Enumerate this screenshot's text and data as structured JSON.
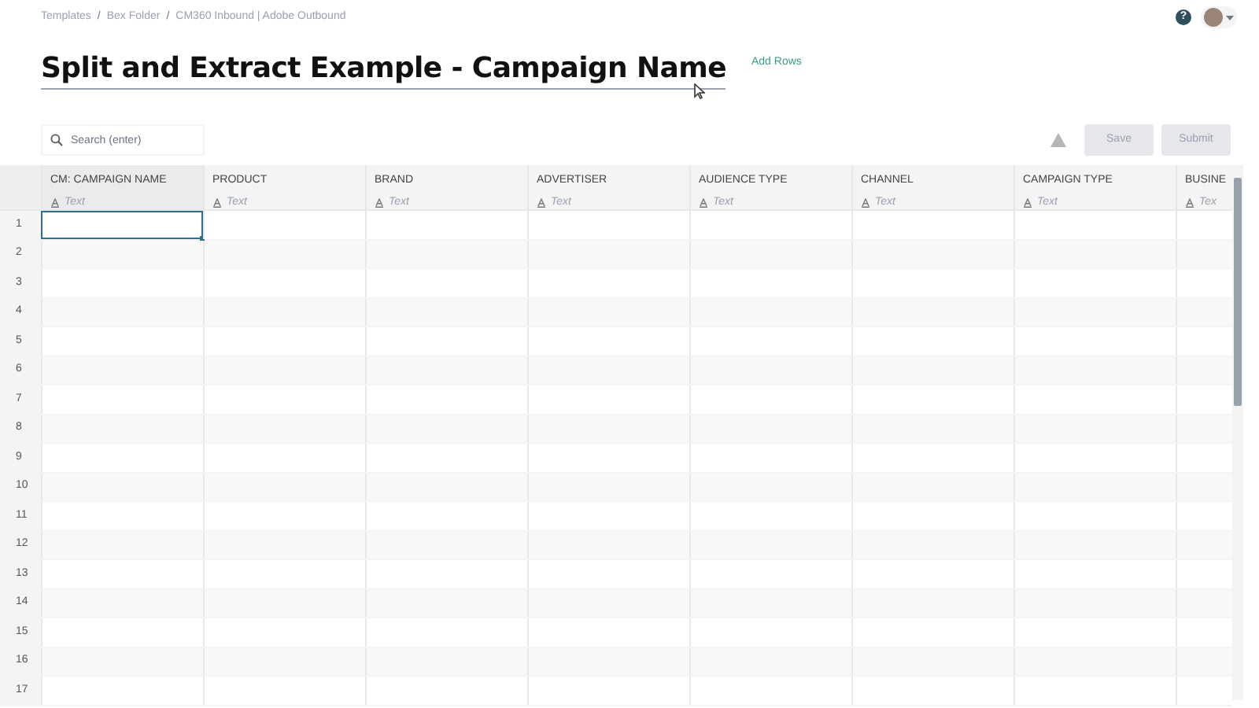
{
  "breadcrumb": {
    "items": [
      "Templates",
      "Bex Folder",
      "CM360 Inbound | Adobe Outbound"
    ],
    "separator": "/"
  },
  "help": {
    "label": "?"
  },
  "title": "Split and Extract Example - Campaign Name",
  "add_rows": "Add Rows",
  "search": {
    "placeholder": "Search (enter)"
  },
  "buttons": [
    {
      "label": "Save",
      "disabled": true
    },
    {
      "label": "Submit",
      "disabled": true
    }
  ],
  "table": {
    "columns": [
      {
        "name": "CM: CAMPAIGN NAME",
        "type": "Text"
      },
      {
        "name": "PRODUCT",
        "type": "Text"
      },
      {
        "name": "BRAND",
        "type": "Text"
      },
      {
        "name": "ADVERTISER",
        "type": "Text"
      },
      {
        "name": "AUDIENCE TYPE",
        "type": "Text"
      },
      {
        "name": "CHANNEL",
        "type": "Text"
      },
      {
        "name": "CAMPAIGN TYPE",
        "type": "Text"
      },
      {
        "name": "BUSINE",
        "type": "Tex"
      }
    ],
    "rows": [
      {
        "number": "1",
        "selected": true
      },
      {
        "number": "2",
        "selected": false
      },
      {
        "number": "3",
        "selected": false
      },
      {
        "number": "4",
        "selected": false
      },
      {
        "number": "5",
        "selected": false
      },
      {
        "number": "6",
        "selected": false
      },
      {
        "number": "7",
        "selected": false
      },
      {
        "number": "8",
        "selected": false
      },
      {
        "number": "9",
        "selected": false
      },
      {
        "number": "10",
        "selected": false
      },
      {
        "number": "11",
        "selected": false
      },
      {
        "number": "12",
        "selected": false
      },
      {
        "number": "13",
        "selected": false
      },
      {
        "number": "14",
        "selected": false
      },
      {
        "number": "15",
        "selected": false
      },
      {
        "number": "16",
        "selected": false
      },
      {
        "number": "17",
        "selected": false
      }
    ]
  }
}
